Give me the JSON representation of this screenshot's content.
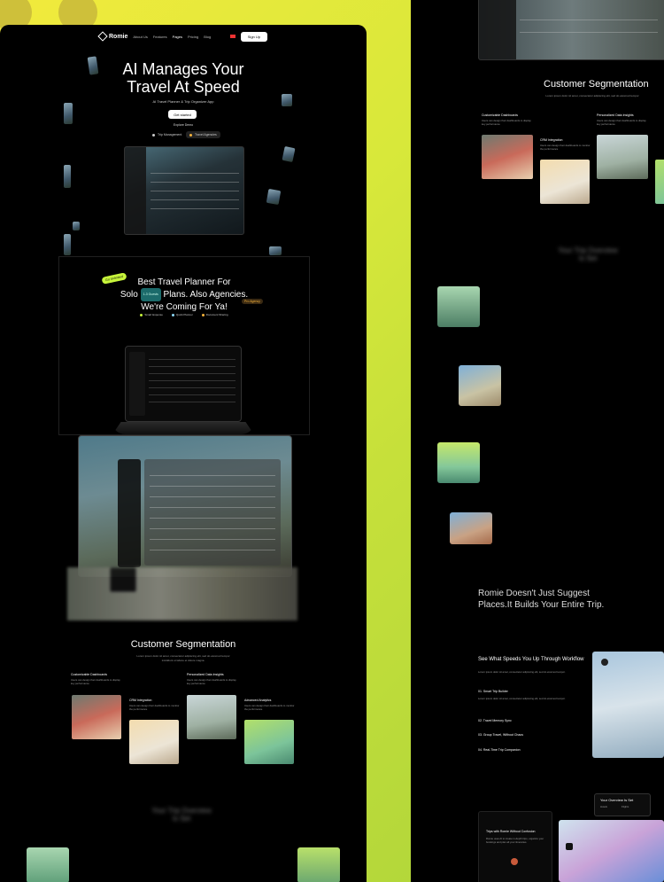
{
  "nav": {
    "brand": "Romie",
    "links": [
      "About Us",
      "Features",
      "Pages",
      "Pricing",
      "Blog"
    ],
    "active_index": 2,
    "signup": "Sign Up"
  },
  "hero": {
    "title_line1": "AI Manages Your",
    "title_line2": "Travel At Speed",
    "subtitle": "AI Travel Planner & Trip Organizer App",
    "cta": "Get started",
    "cta_note": "Explore Demo",
    "toggle_1": "Trip Management",
    "toggle_2": "Travel Agencies"
  },
  "section2": {
    "badge": "Go Unlimited",
    "line1": "Best Travel Planner For",
    "line2_pre": "Solo",
    "line2_tag": "1-3 Guests",
    "line2_post": "Plans. Also Agencies.",
    "line3": "We're Coming For Ya!",
    "orange_tag": "Pro Agency",
    "features": [
      "Smart Expense",
      "Quick Planner",
      "Document Sharing"
    ],
    "feature_colors": [
      "#c7f53b",
      "#8dd8f8",
      "#f4b23b"
    ]
  },
  "segmentation": {
    "title": "Customer Segmentation",
    "subtitle_1": "Lorem ipsum dolor sit amet, consectetur adipiscing elit, sed do eiusmod tempor",
    "subtitle_2": "incididunt ut labore et dolore magna.",
    "cards": [
      {
        "title": "Customizable Dashboards",
        "body": "Users can design their dashboards to display key performance"
      },
      {
        "title": "Personalized Data Insights",
        "body": "Users can design their dashboards to display key performance"
      },
      {
        "title": "CRM Integration",
        "body": "Users can design their dashboards to monitor the performance"
      },
      {
        "title": "Advanced Analytics",
        "body": "Users can design their dashboards to monitor the performance"
      }
    ]
  },
  "blurred_heading": {
    "line1": "Your Trip Overview",
    "line2": "Is Set"
  },
  "right": {
    "tagline_1": "Romie Doesn't Just Suggest",
    "tagline_2": "Places.It Builds Your Entire Trip.",
    "workflow_title": "See What Speeds You Up Through Workflow",
    "workflow_desc": "Lorem ipsum dolor sit amet, consectetur adipiscing elit, sed do eiusmod tempor.",
    "steps": [
      {
        "label": "01.  Smart Trip Builder",
        "desc": "Lorem ipsum dolor sit amet, consectetur adipiscing elit, sed do eiusmod tempor."
      },
      {
        "label": "02.  Travel Memory Sync",
        "desc": ""
      },
      {
        "label": "03.  Group Travel, Without Chaos",
        "desc": ""
      },
      {
        "label": "04.  Real-Time Trip Companion",
        "desc": ""
      }
    ],
    "overview_label": "Your Overview Is Set",
    "overview_items": [
      "Hotels",
      "Flights"
    ],
    "bottom_card_title": "Trips with Romie Without Confusion",
    "bottom_card_desc": "Romie uses AI to create in-depth trips, organize your bookings and plan all your itineraries."
  },
  "colors": {
    "accent_green": "#c7f53b",
    "background_gradient": "#d8e83a",
    "panel": "#000000"
  }
}
